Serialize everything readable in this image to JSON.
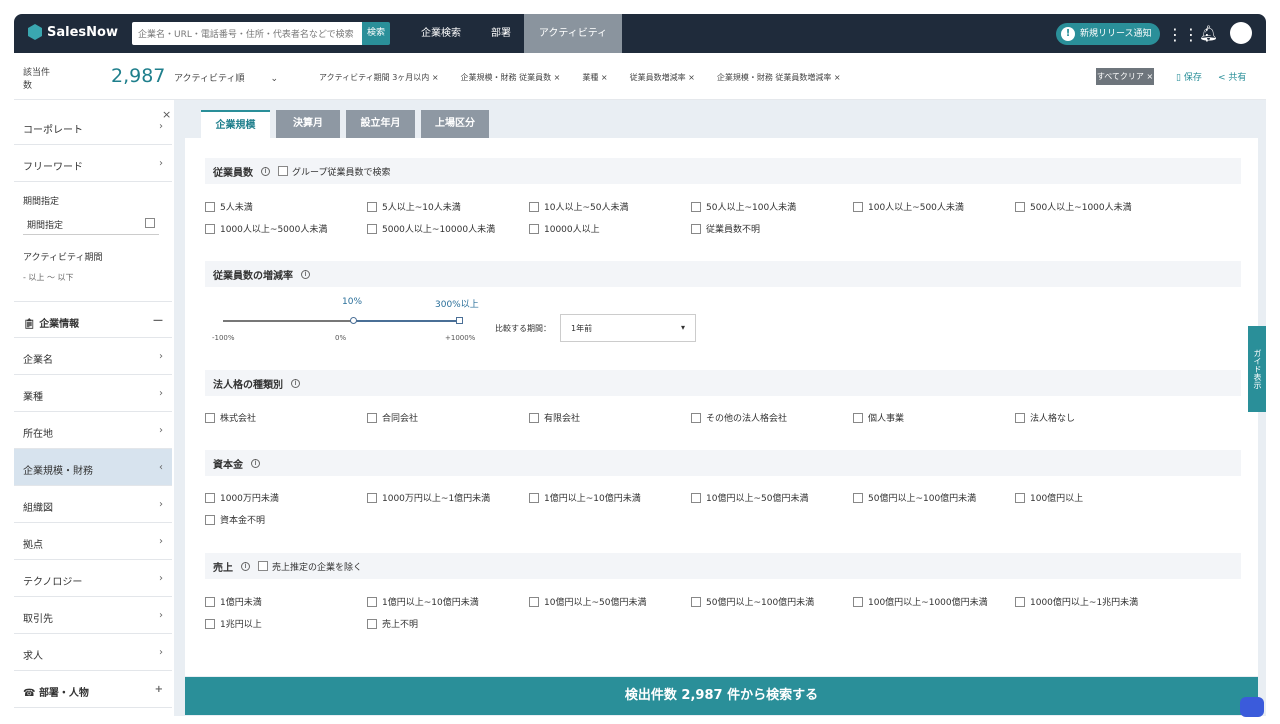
{
  "header": {
    "logo": "SalesNow",
    "search_placeholder": "企業名・URL・電話番号・住所・代表者名などで検索",
    "search_button": "検索",
    "nav": [
      {
        "label": "企業検索"
      },
      {
        "label": "部署"
      },
      {
        "label": "アクティビティ",
        "active": true
      }
    ],
    "release_pill": "新規リリース通知",
    "icons": [
      "apps-grid-icon",
      "bell-icon",
      "user-avatar-icon"
    ]
  },
  "subheader": {
    "count_label": "該当件数",
    "count": "2,987",
    "sort": "アクティビティ順",
    "filters": [
      {
        "label": "アクティビティ期間",
        "value": "3ヶ月以内"
      },
      {
        "label": "企業規模・財務",
        "value": "従業員数"
      },
      {
        "label": "業種",
        "value": ""
      },
      {
        "label": "従業員数増減率",
        "value": ""
      },
      {
        "label": "企業規模・財務",
        "value": "従業員数増減率"
      }
    ],
    "clear": "すべてクリア ×",
    "save": "保存",
    "share": "共有"
  },
  "sidebar": {
    "items": [
      {
        "label": "コーポレート"
      },
      {
        "label": "フリーワード"
      }
    ],
    "period_label": "期間指定",
    "period_value": "期間指定",
    "activity_label": "アクティビティ期間",
    "activity_value": "- 以上 〜 以下",
    "section": "企業情報",
    "section2": "部署・人物",
    "sub_items": [
      {
        "label": "企業名"
      },
      {
        "label": "業種"
      },
      {
        "label": "所在地"
      },
      {
        "label": "企業規模・財務",
        "active": true
      },
      {
        "label": "組織図"
      },
      {
        "label": "拠点"
      },
      {
        "label": "テクノロジー"
      },
      {
        "label": "取引先"
      },
      {
        "label": "求人"
      }
    ]
  },
  "tabs": [
    {
      "label": "企業規模",
      "active": true
    },
    {
      "label": "決算月"
    },
    {
      "label": "設立年月"
    },
    {
      "label": "上場区分"
    }
  ],
  "employees": {
    "title": "従業員数",
    "group_option": "グループ従業員数で検索",
    "options": [
      "5人未満",
      "5人以上~10人未満",
      "10人以上~50人未満",
      "50人以上~100人未満",
      "100人以上~500人未満",
      "500人以上~1000人未満",
      "1000人以上~5000人未満",
      "5000人以上~10000人未満",
      "10000人以上",
      "従業員数不明"
    ]
  },
  "growth": {
    "title": "従業員数の増減率",
    "min_label": "-100%",
    "mid_label": "0%",
    "max_label": "+1000%",
    "selected_low": "10%",
    "selected_high": "300%以上",
    "period_label": "比較する期間：",
    "period_value": "1年前"
  },
  "corp_type": {
    "title": "法人格の種類別",
    "options": [
      "株式会社",
      "合同会社",
      "有限会社",
      "その他の法人格会社",
      "個人事業",
      "法人格なし"
    ]
  },
  "capital": {
    "title": "資本金",
    "options": [
      "1000万円未満",
      "1000万円以上~1億円未満",
      "1億円以上~10億円未満",
      "10億円以上~50億円未満",
      "50億円以上~100億円未満",
      "100億円以上",
      "資本金不明"
    ]
  },
  "sales": {
    "title": "売上",
    "exclude_option": "売上推定の企業を除く",
    "options": [
      "1億円未満",
      "1億円以上~10億円未満",
      "10億円以上~50億円未満",
      "50億円以上~100億円未満",
      "100億円以上~1000億円未満",
      "1000億円以上~1兆円未満",
      "1兆円以上",
      "売上不明"
    ]
  },
  "bottom_button": "検出件数 2,987 件から検索する",
  "side_tab": "ガイド表示",
  "colors": {
    "nav": "#1f2b3b",
    "accent": "#2a8f99"
  }
}
